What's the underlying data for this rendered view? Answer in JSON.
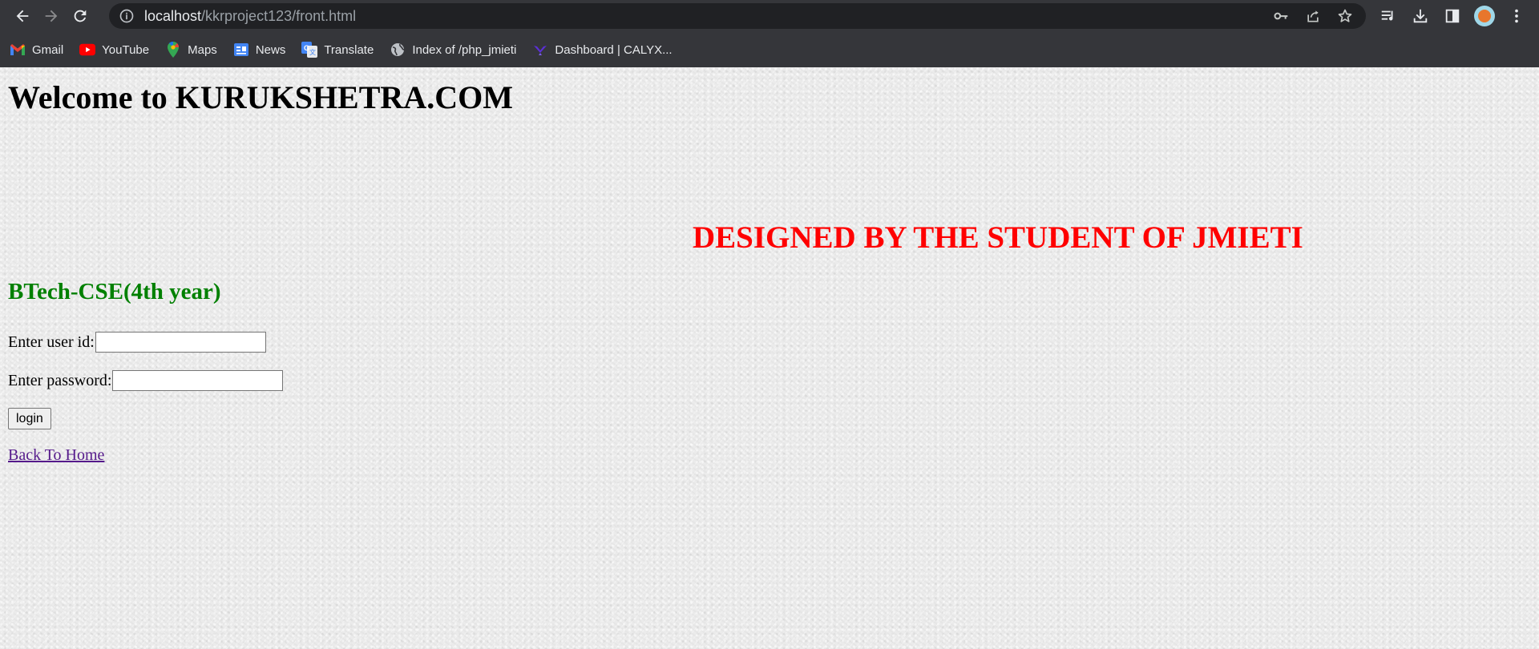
{
  "browser": {
    "url_host": "localhost",
    "url_path": "/kkrproject123/front.html",
    "bookmarks": [
      {
        "label": "Gmail",
        "icon": "gmail-icon"
      },
      {
        "label": "YouTube",
        "icon": "youtube-icon"
      },
      {
        "label": "Maps",
        "icon": "maps-icon"
      },
      {
        "label": "News",
        "icon": "news-icon"
      },
      {
        "label": "Translate",
        "icon": "translate-icon"
      },
      {
        "label": "Index of /php_jmieti",
        "icon": "globe-icon"
      },
      {
        "label": "Dashboard | CALYX...",
        "icon": "calyx-icon"
      }
    ]
  },
  "page": {
    "heading": "Welcome to KURUKSHETRA.COM",
    "marquee": "DESIGNED BY THE STUDENT OF JMIETI",
    "subheading": "BTech-CSE(4th year)",
    "user_label": "Enter user id:",
    "user_value": "",
    "password_label": "Enter password:",
    "password_value": "",
    "login_label": "login",
    "back_link": "Back To Home"
  },
  "colors": {
    "marquee": "#ff0000",
    "subheading": "#008000",
    "link_visited": "#551a8b"
  }
}
